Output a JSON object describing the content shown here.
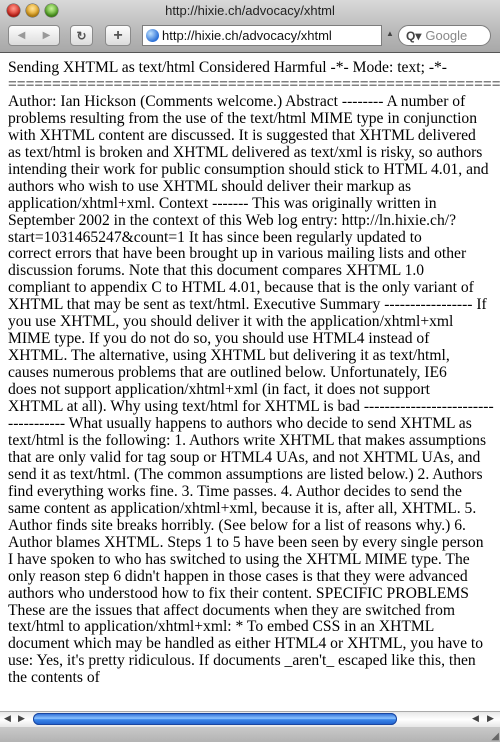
{
  "window": {
    "title": "http://hixie.ch/advocacy/xhtml"
  },
  "toolbar": {
    "back_icon": "◀",
    "forward_icon": "▶",
    "reload_icon": "↻",
    "add_icon": "+",
    "url": "http://hixie.ch/advocacy/xhtml",
    "search_placeholder": "Google",
    "search_icon": "Q▾"
  },
  "content": {
    "lines": [
      "Sending XHTML as text/html Considered Harmful -*- Mode: text; -*-",
      "==============================================================",
      "Author: Ian Hickson (Comments welcome.) Abstract -------- A number of",
      "problems resulting from the use of the text/html MIME type in conjunction",
      "with XHTML content are discussed. It is suggested that XHTML delivered",
      "as text/html is broken and XHTML delivered as text/xml is risky, so authors",
      "intending their work for public consumption should stick to HTML 4.01, and",
      "authors who wish to use XHTML should deliver their markup as",
      "application/xhtml+xml. Context ------- This was originally written in",
      "September 2002 in the context of this Web log entry: http://ln.hixie.ch/?",
      "start=1031465247&count=1 It has since been regularly updated to",
      "correct errors that have been brought up in various mailing lists and other",
      "discussion forums. Note that this document compares XHTML 1.0",
      "compliant to appendix C to HTML 4.01, because that is the only variant of",
      "XHTML that may be sent as text/html. Executive Summary ----------------- If",
      "you use XHTML, you should deliver it with the application/xhtml+xml",
      "MIME type. If you do not do so, you should use HTML4 instead of",
      "XHTML. The alternative, using XHTML but delivering it as text/html,",
      "causes numerous problems that are outlined below. Unfortunately, IE6",
      "does not support application/xhtml+xml (in fact, it does not support",
      "XHTML at all). Why using text/html for XHTML is bad -------------------------",
      "----------- What usually happens to authors who decide to send XHTML as",
      "text/html is the following: 1. Authors write XHTML that makes assumptions",
      "that are only valid for tag soup or HTML4 UAs, and not XHTML UAs, and",
      "send it as text/html. (The common assumptions are listed below.) 2. Authors",
      "find everything works fine. 3. Time passes. 4. Author decides to send the",
      "same content as application/xhtml+xml, because it is, after all, XHTML. 5.",
      "Author finds site breaks horribly. (See below for a list of reasons why.) 6.",
      "Author blames XHTML. Steps 1 to 5 have been seen by every single person",
      "I have spoken to who has switched to using the XHTML MIME type. The",
      "only reason step 6 didn't happen in those cases is that they were advanced",
      "authors who understood how to fix their content. SPECIFIC PROBLEMS",
      "These are the issues that affect documents when they are switched from",
      "text/html to application/xhtml+xml: * To embed CSS in an XHTML",
      "document which may be handled as either HTML4 or XHTML, you have to",
      "use: Yes, it's pretty ridiculous. If documents _aren't_ escaped like this, then",
      "the contents of"
    ]
  },
  "scrollbar": {
    "horizontal_position_percent": 0,
    "visible_fraction": 0.8
  }
}
